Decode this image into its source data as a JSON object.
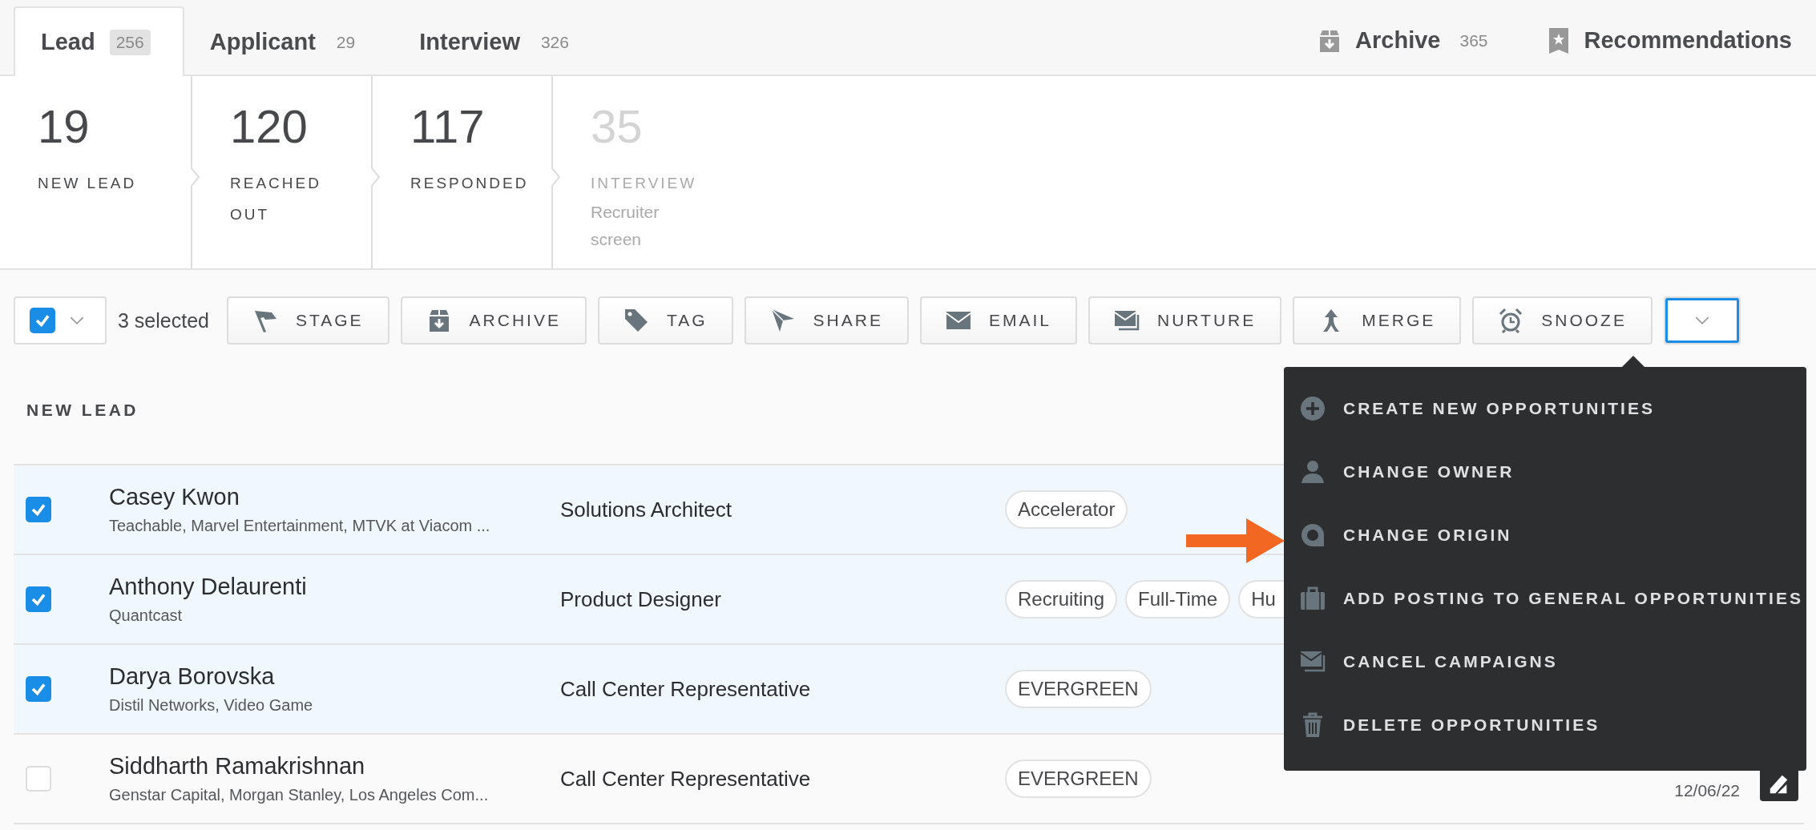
{
  "tabs": [
    {
      "label": "Lead",
      "count": "256",
      "selected": true
    },
    {
      "label": "Applicant",
      "count": "29",
      "selected": false
    },
    {
      "label": "Interview",
      "count": "326",
      "selected": false
    }
  ],
  "side_tabs": [
    {
      "kind": "archive",
      "label": "Archive",
      "count": "365"
    },
    {
      "kind": "recommendations",
      "label": "Recommendations"
    }
  ],
  "stages": [
    {
      "count": "19",
      "label": "NEW LEAD",
      "disabled": false
    },
    {
      "count": "120",
      "label": "REACHED OUT",
      "disabled": false
    },
    {
      "count": "117",
      "label": "RESPONDED",
      "disabled": false
    },
    {
      "count": "35",
      "label": "INTERVIEW",
      "sublabel": "Recruiter screen",
      "disabled": true
    }
  ],
  "toolbar": {
    "select_all": {
      "checked": true
    },
    "selected_count": "3 selected",
    "actions": [
      {
        "kind": "stage",
        "label": "STAGE"
      },
      {
        "kind": "archive",
        "label": "ARCHIVE"
      },
      {
        "kind": "tag",
        "label": "TAG"
      },
      {
        "kind": "share",
        "label": "SHARE"
      },
      {
        "kind": "email",
        "label": "EMAIL"
      },
      {
        "kind": "nurture",
        "label": "NURTURE"
      },
      {
        "kind": "merge",
        "label": "MERGE"
      },
      {
        "kind": "snooze",
        "label": "SNOOZE"
      }
    ],
    "more": {
      "expanded": true
    }
  },
  "section_title": "NEW LEAD",
  "rows": [
    {
      "checked": true,
      "name": "Casey Kwon",
      "companies": "Teachable, Marvel Entertainment, MTVK at Viacom ...",
      "title": "Solutions Architect",
      "tags": [
        "Accelerator"
      ]
    },
    {
      "checked": true,
      "name": "Anthony Delaurenti",
      "companies": "Quantcast",
      "title": "Product Designer",
      "tags": [
        "Recruiting",
        "Full-Time",
        "Hu"
      ]
    },
    {
      "checked": true,
      "name": "Darya Borovska",
      "companies": "Distil Networks, Video Game",
      "title": "Call Center Representative",
      "tags": [
        "EVERGREEN"
      ]
    },
    {
      "checked": false,
      "name": "Siddharth Ramakrishnan",
      "companies": "Genstar Capital, Morgan Stanley, Los Angeles Com...",
      "title": "Call Center Representative",
      "tags": [
        "EVERGREEN"
      ],
      "date": "12/06/22"
    }
  ],
  "menu": {
    "items": [
      {
        "kind": "plus",
        "label": "CREATE NEW OPPORTUNITIES"
      },
      {
        "kind": "person",
        "label": "CHANGE OWNER"
      },
      {
        "kind": "origin",
        "label": "CHANGE ORIGIN"
      },
      {
        "kind": "briefcase",
        "label": "ADD POSTING TO GENERAL OPPORTUNITIES"
      },
      {
        "kind": "campaign",
        "label": "CANCEL CAMPAIGNS"
      },
      {
        "kind": "trash",
        "label": "DELETE OPPORTUNITIES"
      }
    ]
  }
}
